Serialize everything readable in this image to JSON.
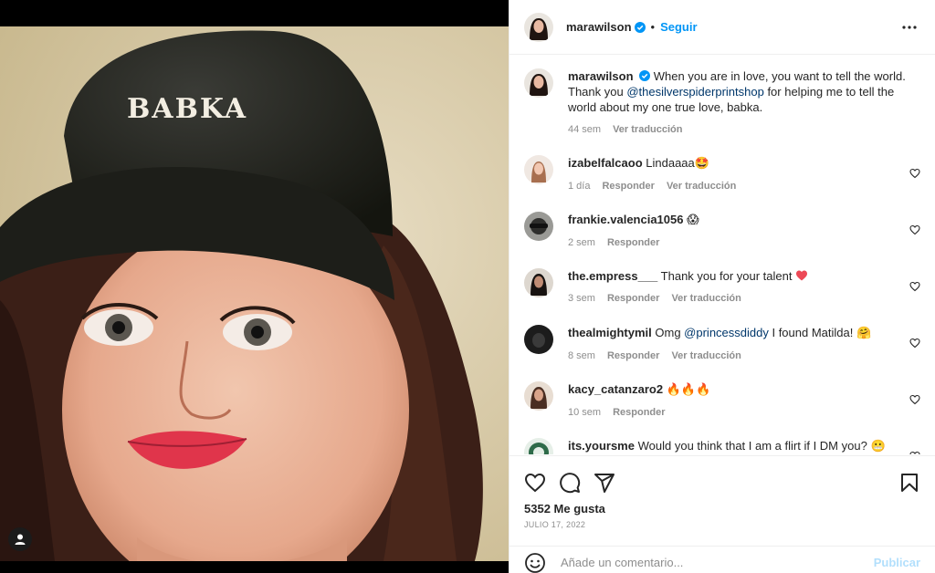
{
  "post": {
    "image_alt": "",
    "hat_text": "BABKA"
  },
  "header": {
    "username": "marawilson",
    "separator": "•",
    "follow_label": "Seguir",
    "more_label": "•••"
  },
  "caption": {
    "username": "marawilson",
    "text_part1": "When you are in love, you want to tell the world. Thank you ",
    "mention": "@thesilverspiderprintshop",
    "text_part2": " for helping me to tell the world about my one true love, babka.",
    "age": "44 sem",
    "translate": "Ver traducción"
  },
  "comments": [
    {
      "username": "izabelfalcaoo",
      "text": "Lindaaaa",
      "emoji": "🤩",
      "age": "1 día",
      "reply": "Responder",
      "translate": "Ver traducción"
    },
    {
      "username": "frankie.valencia1056",
      "text": "",
      "emoji": "😱",
      "age": "2 sem",
      "reply": "Responder",
      "translate": ""
    },
    {
      "username": "the.empress___",
      "text": "Thank you for your talent",
      "emoji": "❤",
      "age": "3 sem",
      "reply": "Responder",
      "translate": "Ver traducción"
    },
    {
      "username": "thealmightymil",
      "text_pre": "Omg ",
      "mention": "@princessdiddy",
      "text": " I found Matilda!",
      "emoji": "🤗",
      "age": "8 sem",
      "reply": "Responder",
      "translate": "Ver traducción"
    },
    {
      "username": "kacy_catanzaro2",
      "text": "",
      "emoji": "🔥🔥🔥",
      "age": "10 sem",
      "reply": "Responder",
      "translate": ""
    },
    {
      "username": "its.yoursme",
      "text": "Would you think that I am a flirt if I DM you?",
      "emoji": "😬",
      "age": "",
      "reply": "",
      "translate": ""
    }
  ],
  "likes": "5352 Me gusta",
  "date": "JULIO 17, 2022",
  "composer": {
    "placeholder": "Añade un comentario...",
    "publish_label": "Publicar"
  },
  "colors": {
    "accent": "#0095f6",
    "mention": "#00376b",
    "muted": "#8e8e8e",
    "publish_disabled": "#b2dffc",
    "heart_red": "#ed4956"
  }
}
